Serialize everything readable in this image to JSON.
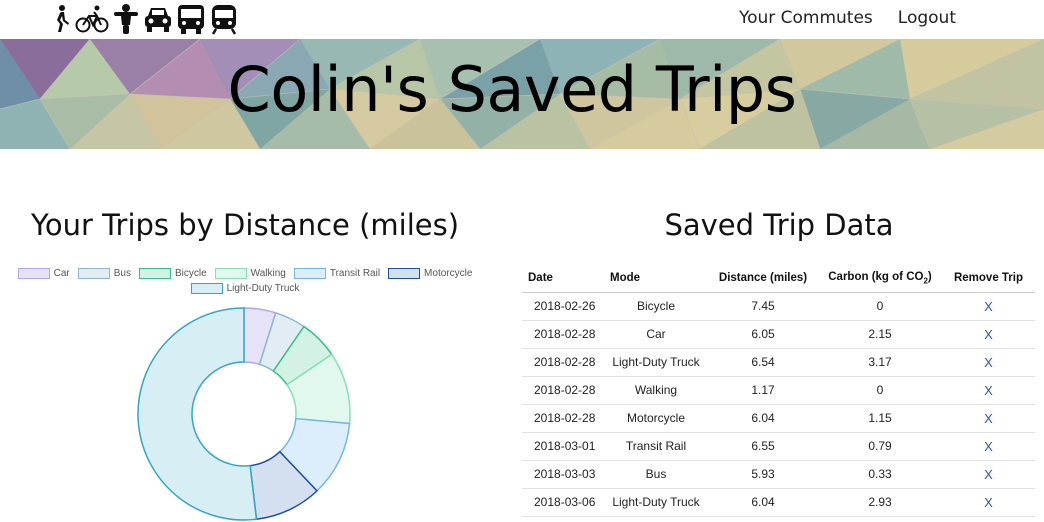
{
  "nav": {
    "mode_icons": [
      "walking-icon",
      "bicycle-icon",
      "motorcycle-icon",
      "car-icon",
      "bus-icon",
      "transit-rail-icon"
    ],
    "links": [
      {
        "label": "Your Commutes"
      },
      {
        "label": "Logout"
      }
    ]
  },
  "hero": {
    "title": "Colin's Saved Trips"
  },
  "chart_section": {
    "title": "Your Trips by Distance (miles)"
  },
  "chart_data": {
    "type": "pie",
    "donut": true,
    "categories": [
      "Car",
      "Bus",
      "Bicycle",
      "Walking",
      "Transit Rail",
      "Motorcycle",
      "Light-Duty Truck"
    ],
    "values": [
      6.05,
      5.93,
      7.45,
      1.17,
      6.55,
      6.04,
      12.58
    ],
    "series_segments": [
      {
        "label": "Car",
        "value": 6.05
      },
      {
        "label": "Bus",
        "value": 5.93
      },
      {
        "label": "Bicycle",
        "value": 7.45
      },
      {
        "label": "Walking",
        "value": 13.68
      },
      {
        "label": "Transit Rail",
        "value": 14.4
      },
      {
        "label": "Motorcycle",
        "value": 12.8
      },
      {
        "label": "Light-Duty Truck",
        "value": 65.0
      }
    ],
    "legend_position": "top",
    "colors": {
      "Car": {
        "fill": "#e6e2f7",
        "stroke": "#b3a6ea"
      },
      "Bus": {
        "fill": "#e1edf2",
        "stroke": "#8fb8cf"
      },
      "Bicycle": {
        "fill": "#d3f2e4",
        "stroke": "#34c28a"
      },
      "Walking": {
        "fill": "#e1f8ec",
        "stroke": "#86e0b3"
      },
      "Transit Rail": {
        "fill": "#dcedfb",
        "stroke": "#71b7ea"
      },
      "Motorcycle": {
        "fill": "#d4dff0",
        "stroke": "#1d4fa3"
      },
      "Light-Duty Truck": {
        "fill": "#d8eef5",
        "stroke": "#32a6c6"
      }
    }
  },
  "table_section": {
    "title": "Saved Trip Data",
    "columns": {
      "date": "Date",
      "mode": "Mode",
      "distance": "Distance (miles)",
      "carbon_prefix": "Carbon (kg of CO",
      "carbon_sub": "2",
      "carbon_suffix": ")",
      "remove": "Remove Trip"
    },
    "rows": [
      {
        "date": "2018-02-26",
        "mode": "Bicycle",
        "distance": "7.45",
        "carbon": "0",
        "remove": "X"
      },
      {
        "date": "2018-02-28",
        "mode": "Car",
        "distance": "6.05",
        "carbon": "2.15",
        "remove": "X"
      },
      {
        "date": "2018-02-28",
        "mode": "Light-Duty Truck",
        "distance": "6.54",
        "carbon": "3.17",
        "remove": "X"
      },
      {
        "date": "2018-02-28",
        "mode": "Walking",
        "distance": "1.17",
        "carbon": "0",
        "remove": "X"
      },
      {
        "date": "2018-02-28",
        "mode": "Motorcycle",
        "distance": "6.04",
        "carbon": "1.15",
        "remove": "X"
      },
      {
        "date": "2018-03-01",
        "mode": "Transit Rail",
        "distance": "6.55",
        "carbon": "0.79",
        "remove": "X"
      },
      {
        "date": "2018-03-03",
        "mode": "Bus",
        "distance": "5.93",
        "carbon": "0.33",
        "remove": "X"
      },
      {
        "date": "2018-03-06",
        "mode": "Light-Duty Truck",
        "distance": "6.04",
        "carbon": "2.93",
        "remove": "X"
      }
    ]
  }
}
